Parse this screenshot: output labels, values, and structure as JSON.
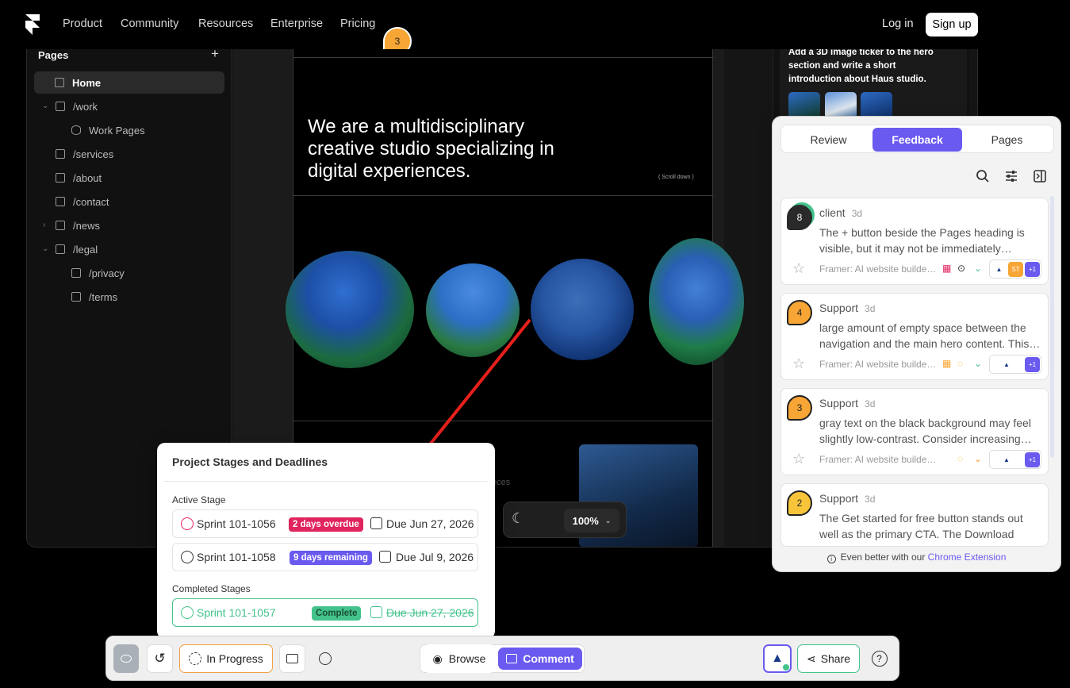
{
  "nav": {
    "links": [
      "Product",
      "Community",
      "Resources",
      "Enterprise",
      "Pricing"
    ],
    "login": "Log in",
    "signup": "Sign up",
    "pin_count": "3"
  },
  "pages_panel": {
    "title": "Pages",
    "add": "+",
    "items": [
      {
        "label": "Home"
      },
      {
        "label": "/work"
      },
      {
        "label": "Work Pages"
      },
      {
        "label": "/services"
      },
      {
        "label": "/about"
      },
      {
        "label": "/contact"
      },
      {
        "label": "/news"
      },
      {
        "label": "/legal"
      },
      {
        "label": "/privacy"
      },
      {
        "label": "/terms"
      }
    ]
  },
  "site": {
    "hero": "We are a multidisciplinary creative studio specializing in digital experiences.",
    "scroll": "( Scroll down )",
    "faded_text": "nces"
  },
  "canvas_toolbar": {
    "zoom": "100%"
  },
  "ai_prompt": {
    "text": "Add a 3D image ticker to the hero section and write a short introduction about Haus studio."
  },
  "feedback": {
    "tabs": [
      "Review",
      "Feedback",
      "Pages"
    ],
    "active_tab": "Feedback",
    "cards": [
      {
        "count": "8",
        "author": "client",
        "age": "3d",
        "text": "The + button beside the Pages heading is visible, but it may not be immediately…",
        "source": "Framer: AI website builder…",
        "badge_color": "#2a2a2a",
        "extra": "+1",
        "av2": "ST"
      },
      {
        "count": "4",
        "author": "Support",
        "age": "3d",
        "text": "large amount of empty space between the navigation and the main hero content. This…",
        "source": "Framer: AI website builder…",
        "badge_color": "#f7a534",
        "extra": "+1"
      },
      {
        "count": "3",
        "author": "Support",
        "age": "3d",
        "text": "gray text on the black background may feel slightly low-contrast. Consider increasing…",
        "source": "Framer: AI website builder for…",
        "badge_color": "#f7a534",
        "extra": "+1"
      },
      {
        "count": "2",
        "author": "Support",
        "age": "3d",
        "text": "The Get started for free button stands out well as the primary CTA. The Download app…",
        "source": "",
        "badge_color": "#f8c53a",
        "extra": ""
      }
    ],
    "footer_prefix": "Even better with our",
    "footer_link": "Chrome Extension"
  },
  "stages": {
    "title": "Project Stages and Deadlines",
    "active_label": "Active Stage",
    "completed_label": "Completed Stages",
    "active": [
      {
        "name": "Sprint 101-1056",
        "chip": "2 days overdue",
        "chip_color": "#e0245e",
        "due": "Due Jun 27, 2026"
      },
      {
        "name": "Sprint 101-1058",
        "chip": "9 days remaining",
        "chip_color": "#6a5af0",
        "due": "Due Jul 9, 2026"
      }
    ],
    "completed": [
      {
        "name": "Sprint 101-1057",
        "chip": "Complete",
        "chip_color": "#43c38b",
        "due": "Due Jun 27, 2026"
      }
    ]
  },
  "bottombar": {
    "status": "In Progress",
    "browse": "Browse",
    "comment": "Comment",
    "share": "Share",
    "help": "?"
  },
  "colors": {
    "accent": "#6a5af0",
    "arrow": "#e8201b"
  }
}
